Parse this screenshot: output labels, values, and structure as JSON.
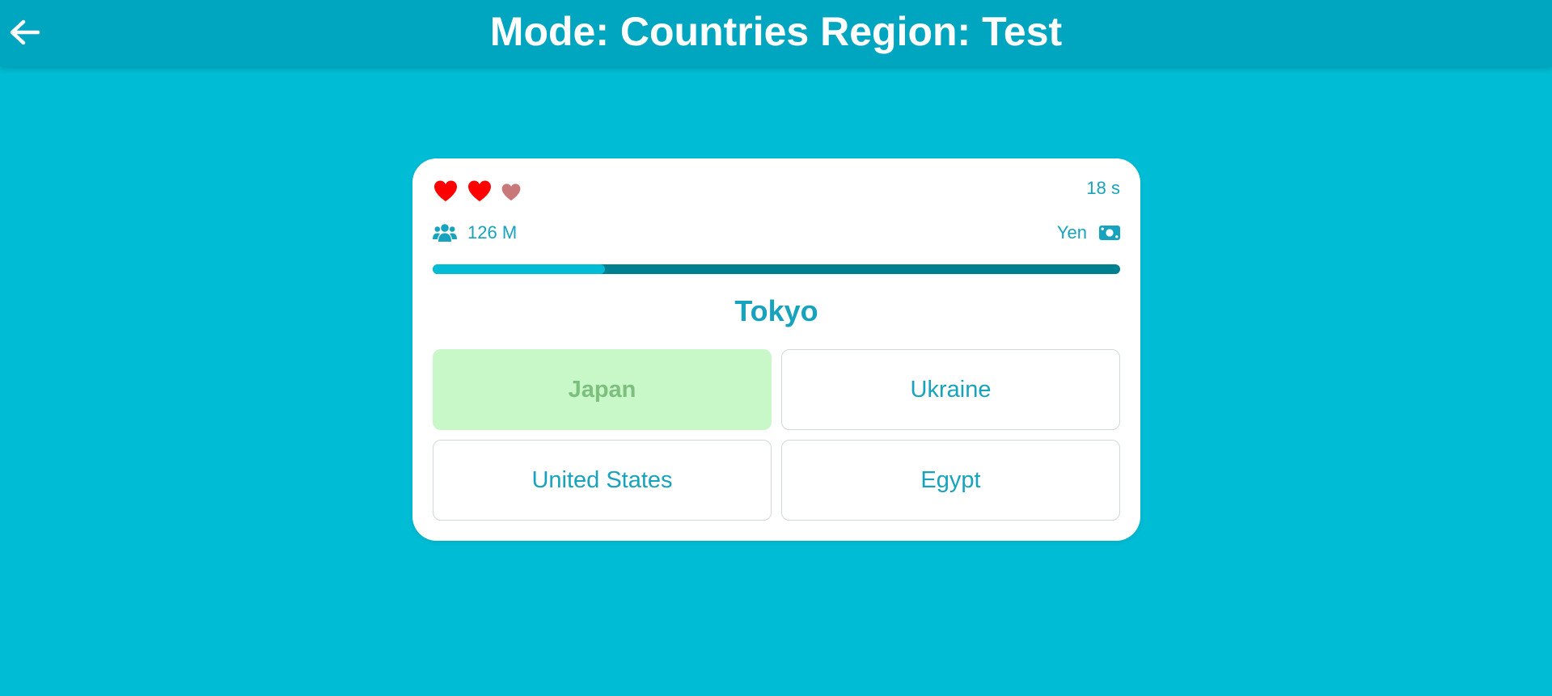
{
  "header": {
    "title": "Mode: Countries Region: Test",
    "back_icon": "arrow-left-icon"
  },
  "card": {
    "lives": {
      "total": 3,
      "remaining": 2,
      "full_color": "#ff0000",
      "lost_color": "#c9787a",
      "icon": "heart-icon"
    },
    "timer": "18 s",
    "population": {
      "icon": "users-icon",
      "value": "126 M"
    },
    "currency": {
      "label": "Yen",
      "icon": "money-bill-icon"
    },
    "progress": {
      "fraction": 0.25,
      "track_color": "#007f91",
      "fill_color": "#00bcd4"
    },
    "question": "Tokyo",
    "answers": [
      {
        "label": "Japan",
        "state": "correct"
      },
      {
        "label": "Ukraine",
        "state": "default"
      },
      {
        "label": "United States",
        "state": "default"
      },
      {
        "label": "Egypt",
        "state": "default"
      }
    ]
  },
  "colors": {
    "background": "#00bcd4",
    "header": "#00a6bf",
    "accent_text": "#17a3bd",
    "correct_bg": "#c8f7c8",
    "correct_text": "#7cbf7e"
  }
}
